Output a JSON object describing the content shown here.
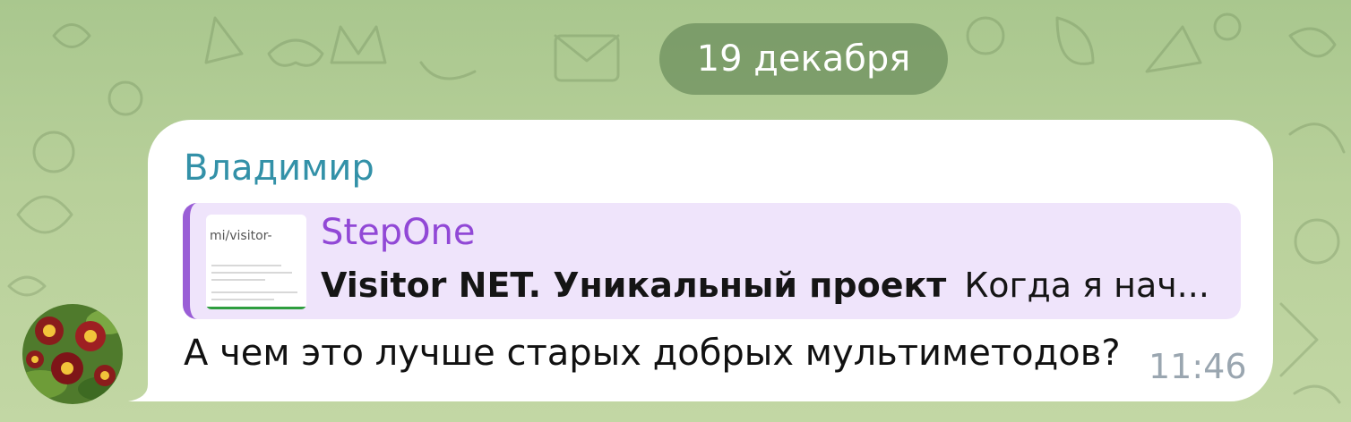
{
  "date_badge": "19 декабря",
  "message": {
    "sender": "Владимир",
    "text": "А чем это лучше старых добрых мультиметодов?",
    "time": "11:46",
    "link_preview": {
      "source": "StepOne",
      "title": "Visitor NET. Уникальный проект",
      "description": "Когда я нач...",
      "thumbnail_title": "mi/visitor-"
    }
  },
  "colors": {
    "background": "#b5cf97",
    "bubble": "#ffffff",
    "sender_name": "#3391a8",
    "preview_bg": "#efe4fb",
    "preview_accent": "#9a5ed6",
    "preview_source": "#9148d6",
    "date_pill": "#6c8e5a",
    "time": "#9aa6b0"
  }
}
